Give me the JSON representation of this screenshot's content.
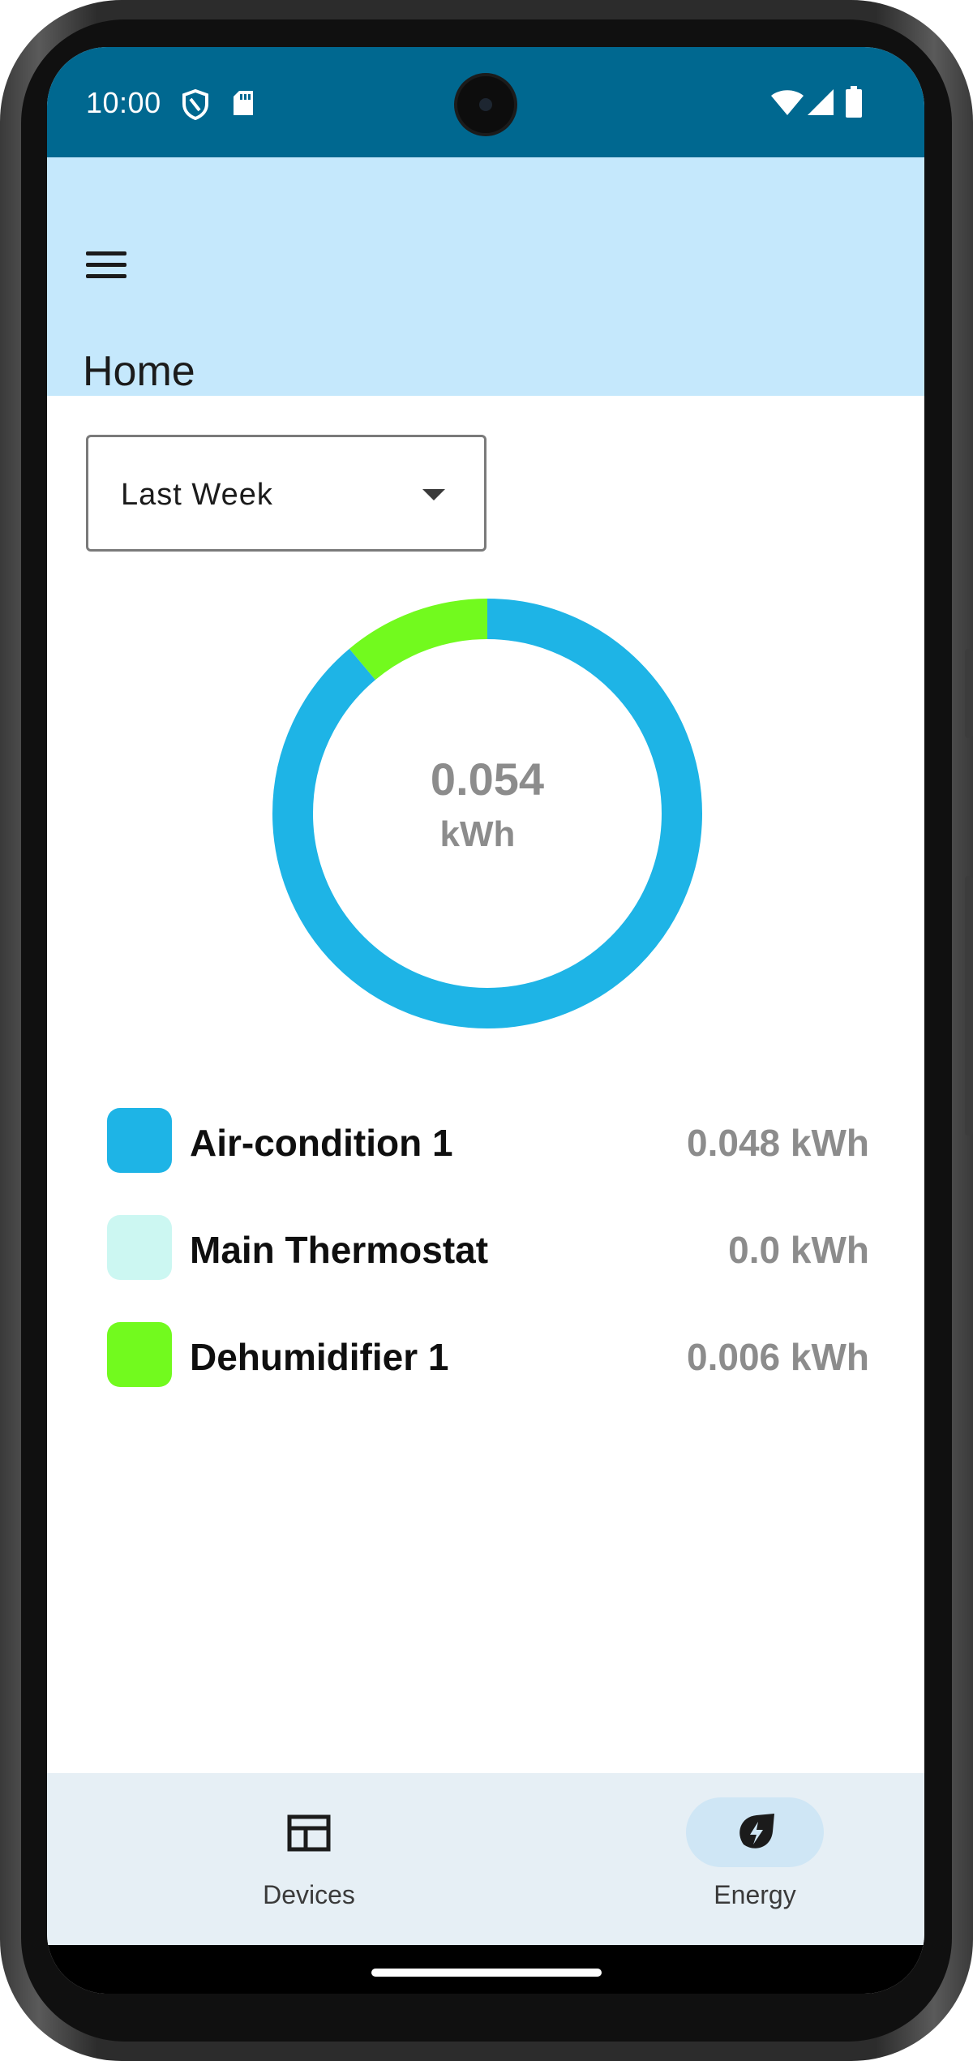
{
  "status_bar": {
    "time": "10:00",
    "left_icons": [
      "shield-icon",
      "sd-card-icon"
    ],
    "right_icons": [
      "wifi-icon",
      "cellular-signal-icon",
      "battery-icon"
    ]
  },
  "app_bar": {
    "menu_icon": "menu-icon",
    "title": "Home"
  },
  "period_select": {
    "selected": "Last Week"
  },
  "chart_data": {
    "type": "pie",
    "total_label": "0.054",
    "total_unit": "kWh",
    "slices": [
      {
        "name": "Air-condition 1",
        "value": 0.048,
        "color": "#1eb4e6"
      },
      {
        "name": "Main Thermostat",
        "value": 0.0,
        "color": "#ccf7f2"
      },
      {
        "name": "Dehumidifier 1",
        "value": 0.006,
        "color": "#72fa1e"
      }
    ]
  },
  "legend": [
    {
      "name": "Air-condition 1",
      "value": "0.048 kWh",
      "color": "#1eb4e6"
    },
    {
      "name": "Main Thermostat",
      "value": "0.0 kWh",
      "color": "#ccf7f2"
    },
    {
      "name": "Dehumidifier 1",
      "value": "0.006 kWh",
      "color": "#72fa1e"
    }
  ],
  "bottom_nav": {
    "items": [
      {
        "label": "Devices",
        "icon": "devices-icon",
        "selected": false
      },
      {
        "label": "Energy",
        "icon": "energy-icon",
        "selected": true
      }
    ],
    "selected_pill_color": "#cfe6f5"
  },
  "colors": {
    "status_bar": "#006890",
    "app_bar": "#c5e8fc"
  }
}
